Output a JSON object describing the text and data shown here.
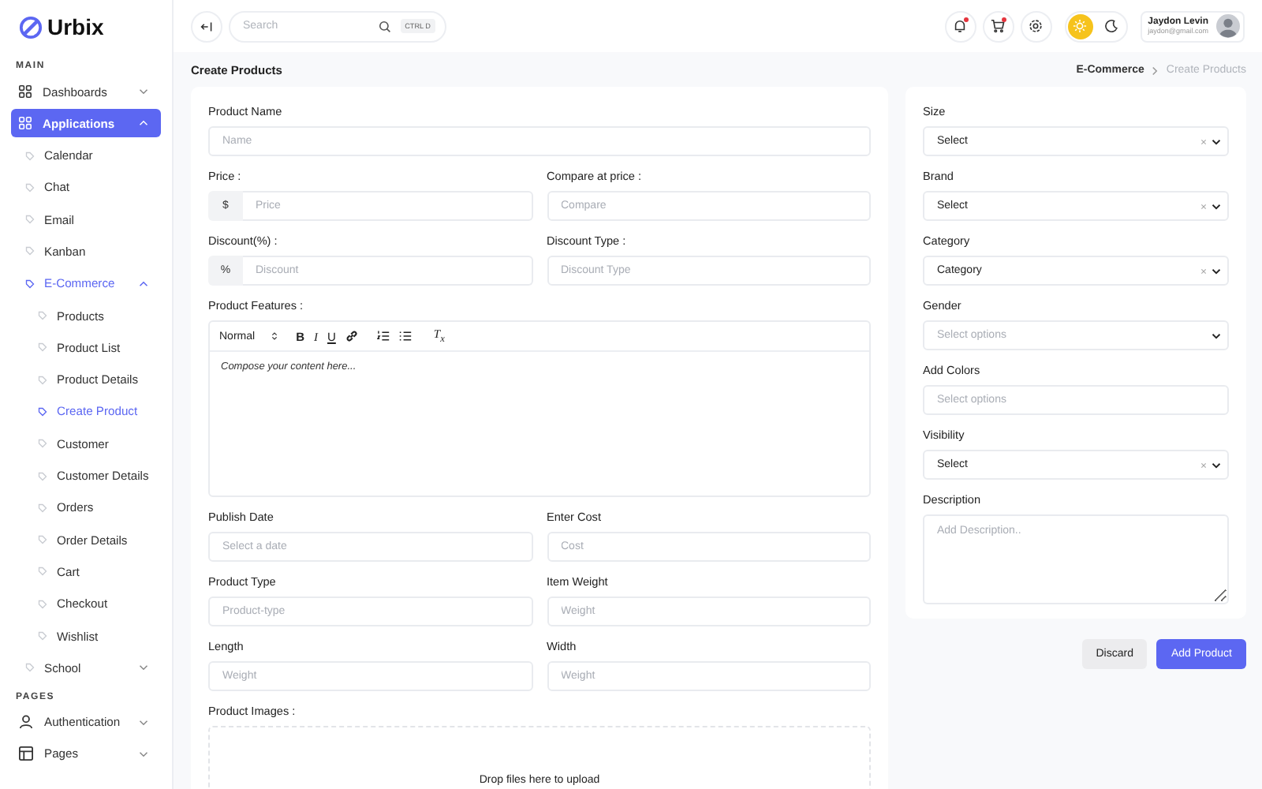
{
  "brand": {
    "name": "Urbix"
  },
  "sidebar": {
    "sections": [
      {
        "heading": "MAIN",
        "items": [
          {
            "label": "Dashboards",
            "selected": false,
            "expanded": false
          },
          {
            "label": "Applications",
            "selected": true,
            "expanded": true,
            "children": [
              {
                "label": "Calendar",
                "selected": false
              },
              {
                "label": "Chat",
                "selected": false
              },
              {
                "label": "Email",
                "selected": false
              },
              {
                "label": "Kanban",
                "selected": false
              },
              {
                "label": "E-Commerce",
                "selected": true,
                "expanded": true,
                "children": [
                  {
                    "label": "Products",
                    "selected": false
                  },
                  {
                    "label": "Product List",
                    "selected": false
                  },
                  {
                    "label": "Product Details",
                    "selected": false
                  },
                  {
                    "label": "Create Product",
                    "selected": true
                  },
                  {
                    "label": "Customer",
                    "selected": false
                  },
                  {
                    "label": "Customer Details",
                    "selected": false
                  },
                  {
                    "label": "Orders",
                    "selected": false
                  },
                  {
                    "label": "Order Details",
                    "selected": false
                  },
                  {
                    "label": "Cart",
                    "selected": false
                  },
                  {
                    "label": "Checkout",
                    "selected": false
                  },
                  {
                    "label": "Wishlist",
                    "selected": false
                  }
                ]
              },
              {
                "label": "School",
                "selected": false,
                "expanded": false
              }
            ]
          }
        ]
      },
      {
        "heading": "PAGES",
        "items": [
          {
            "label": "Authentication",
            "selected": false,
            "expanded": false
          },
          {
            "label": "Pages",
            "selected": false,
            "expanded": false
          }
        ]
      }
    ]
  },
  "header": {
    "search": {
      "placeholder": "Search",
      "shortcut": "CTRL D"
    },
    "actions": [
      {
        "kind": "bell",
        "badge": true
      },
      {
        "kind": "cart",
        "badge": true
      },
      {
        "kind": "settings",
        "badge": false
      }
    ],
    "theme_modes": [
      {
        "kind": "light",
        "selected": true
      },
      {
        "kind": "dark",
        "selected": false
      }
    ],
    "user": {
      "name": "Jaydon Levin",
      "email": "jaydon@gmail.com"
    }
  },
  "page": {
    "title": "Create Products",
    "breadcrumb": [
      {
        "label": "E-Commerce",
        "current": false
      },
      {
        "label": "Create Products",
        "current": true
      }
    ]
  },
  "product_form": {
    "rows": [
      {
        "fields": [
          {
            "kind": "text",
            "label": "Product Name",
            "placeholder": "Name"
          }
        ]
      },
      {
        "fields": [
          {
            "kind": "prefixed",
            "label": "Price :",
            "prefix": "$",
            "placeholder": "Price"
          },
          {
            "kind": "text",
            "label": "Compare at price :",
            "placeholder": "Compare"
          }
        ]
      },
      {
        "fields": [
          {
            "kind": "prefixed",
            "label": "Discount(%) :",
            "prefix": "%",
            "placeholder": "Discount"
          },
          {
            "kind": "text",
            "label": "Discount Type :",
            "placeholder": "Discount Type"
          }
        ]
      },
      {
        "fields": [
          {
            "kind": "editor",
            "label": "Product Features :",
            "format": "Normal",
            "placeholder": "Compose your content here...",
            "buttons": [
              {
                "kind": "bold",
                "label": "B"
              },
              {
                "kind": "italic",
                "label": "I"
              },
              {
                "kind": "underline",
                "label": "U"
              },
              {
                "kind": "link"
              },
              {
                "kind": "ordered-list"
              },
              {
                "kind": "bullet-list"
              },
              {
                "kind": "clean",
                "label": "T$_{x}$"
              }
            ]
          }
        ]
      },
      {
        "fields": [
          {
            "kind": "text",
            "label": "Publish Date",
            "placeholder": "Select a date"
          },
          {
            "kind": "text",
            "label": "Enter Cost",
            "placeholder": "Cost"
          }
        ]
      },
      {
        "fields": [
          {
            "kind": "text",
            "label": "Product Type",
            "placeholder": "Product-type"
          },
          {
            "kind": "text",
            "label": "Item Weight",
            "placeholder": "Weight"
          }
        ]
      },
      {
        "fields": [
          {
            "kind": "text",
            "label": "Length",
            "placeholder": "Weight"
          },
          {
            "kind": "text",
            "label": "Width",
            "placeholder": "Weight"
          }
        ]
      },
      {
        "fields": [
          {
            "kind": "dropzone",
            "label": "Product Images :",
            "text": "Drop files here to upload"
          }
        ]
      }
    ]
  },
  "details_form": {
    "fields": [
      {
        "kind": "select",
        "label": "Size",
        "value": "Select",
        "clearable": true
      },
      {
        "kind": "select",
        "label": "Brand",
        "value": "Select",
        "clearable": true
      },
      {
        "kind": "select",
        "label": "Category",
        "value": "Category",
        "clearable": true
      },
      {
        "kind": "select",
        "label": "Gender",
        "placeholder": "Select options",
        "clearable": false
      },
      {
        "kind": "multiselect",
        "label": "Add Colors",
        "placeholder": "Select options"
      },
      {
        "kind": "select",
        "label": "Visibility",
        "value": "Select",
        "clearable": true
      },
      {
        "kind": "textarea",
        "label": "Description",
        "placeholder": "Add Description.."
      }
    ]
  },
  "buttons": [
    {
      "kind": "secondary",
      "label": "Discard"
    },
    {
      "kind": "primary",
      "label": "Add Product"
    }
  ]
}
